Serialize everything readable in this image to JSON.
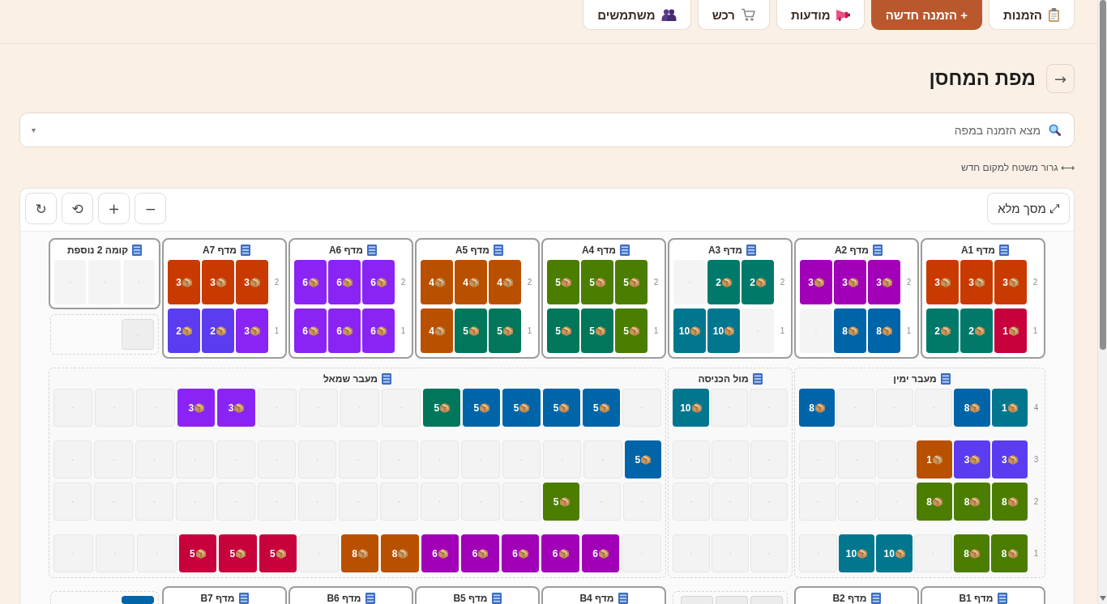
{
  "nav": [
    {
      "label": "הזמנות",
      "primary": false
    },
    {
      "label": "+ הזמנה חדשה",
      "primary": true
    },
    {
      "label": "מודעות",
      "primary": false
    },
    {
      "label": "רכש",
      "primary": false
    },
    {
      "label": "משתמשים",
      "primary": false
    }
  ],
  "header": {
    "back": "→",
    "title": "מפת המחסן"
  },
  "search": {
    "placeholder": "מצא הזמנה במפה",
    "caret": "▾"
  },
  "hint": "⟷ גרור משטח למקום חדש",
  "map": {
    "fullscreen": "⤢ מסך מלא",
    "tools": [
      "−",
      "+",
      "⟲",
      "↻"
    ],
    "top_row": [
      {
        "kind": "shelf",
        "title": "מדף A1",
        "levels": [
          {
            "label": "2",
            "slots": [
              {
                "kind": "pallet",
                "count": "3",
                "color": "#c93a00"
              },
              {
                "kind": "pallet",
                "count": "3",
                "color": "#c93a00"
              },
              {
                "kind": "pallet",
                "count": "3",
                "color": "#c93a00"
              }
            ]
          },
          {
            "label": "1",
            "slots": [
              {
                "kind": "pallet",
                "count": "1",
                "color": "#c8003c"
              },
              {
                "kind": "pallet",
                "count": "2",
                "color": "#00796b"
              },
              {
                "kind": "pallet",
                "count": "2",
                "color": "#00796b"
              }
            ]
          }
        ]
      },
      {
        "kind": "shelf",
        "title": "מדף A2",
        "levels": [
          {
            "label": "2",
            "slots": [
              {
                "kind": "pallet",
                "count": "3",
                "color": "#a100b8"
              },
              {
                "kind": "pallet",
                "count": "3",
                "color": "#a100b8"
              },
              {
                "kind": "pallet",
                "count": "3",
                "color": "#a100b8"
              }
            ]
          },
          {
            "label": "1",
            "slots": [
              {
                "kind": "pallet",
                "count": "8",
                "color": "#0064a8"
              },
              {
                "kind": "pallet",
                "count": "8",
                "color": "#0064a8"
              },
              {
                "kind": "empty",
                "label": "·"
              }
            ]
          }
        ]
      },
      {
        "kind": "shelf",
        "title": "מדף A3",
        "levels": [
          {
            "label": "2",
            "slots": [
              {
                "kind": "pallet",
                "count": "2",
                "color": "#00796b"
              },
              {
                "kind": "pallet",
                "count": "2",
                "color": "#00796b"
              },
              {
                "kind": "empty",
                "label": "·"
              }
            ]
          },
          {
            "label": "1",
            "slots": [
              {
                "kind": "empty",
                "label": "·"
              },
              {
                "kind": "pallet",
                "count": "10",
                "color": "#00778f"
              },
              {
                "kind": "pallet",
                "count": "10",
                "color": "#00778f"
              }
            ]
          }
        ]
      },
      {
        "kind": "shelf",
        "title": "מדף A4",
        "levels": [
          {
            "label": "2",
            "slots": [
              {
                "kind": "pallet",
                "count": "5",
                "color": "#4b7d00"
              },
              {
                "kind": "pallet",
                "count": "5",
                "color": "#4b7d00"
              },
              {
                "kind": "pallet",
                "count": "5",
                "color": "#4b7d00"
              }
            ]
          },
          {
            "label": "1",
            "slots": [
              {
                "kind": "pallet",
                "count": "5",
                "color": "#4b7d00"
              },
              {
                "kind": "pallet",
                "count": "5",
                "color": "#00775a"
              },
              {
                "kind": "pallet",
                "count": "5",
                "color": "#00775a"
              }
            ]
          }
        ]
      },
      {
        "kind": "shelf",
        "title": "מדף A5",
        "levels": [
          {
            "label": "2",
            "slots": [
              {
                "kind": "pallet",
                "count": "4",
                "color": "#b95000"
              },
              {
                "kind": "pallet",
                "count": "4",
                "color": "#b95000"
              },
              {
                "kind": "pallet",
                "count": "4",
                "color": "#b95000"
              }
            ]
          },
          {
            "label": "1",
            "slots": [
              {
                "kind": "pallet",
                "count": "5",
                "color": "#00775a"
              },
              {
                "kind": "pallet",
                "count": "5",
                "color": "#00775a"
              },
              {
                "kind": "pallet",
                "count": "4",
                "color": "#b95000"
              }
            ]
          }
        ]
      },
      {
        "kind": "shelf",
        "title": "מדף A6",
        "levels": [
          {
            "label": "2",
            "slots": [
              {
                "kind": "pallet",
                "count": "6",
                "color": "#8a24f5"
              },
              {
                "kind": "pallet",
                "count": "6",
                "color": "#8a24f5"
              },
              {
                "kind": "pallet",
                "count": "6",
                "color": "#8a24f5"
              }
            ]
          },
          {
            "label": "1",
            "slots": [
              {
                "kind": "pallet",
                "count": "6",
                "color": "#8a24f5"
              },
              {
                "kind": "pallet",
                "count": "6",
                "color": "#8a24f5"
              },
              {
                "kind": "pallet",
                "count": "6",
                "color": "#8a24f5"
              }
            ]
          }
        ]
      },
      {
        "kind": "shelf",
        "title": "מדף A7",
        "levels": [
          {
            "label": "2",
            "slots": [
              {
                "kind": "pallet",
                "count": "3",
                "color": "#c93a00"
              },
              {
                "kind": "pallet",
                "count": "3",
                "color": "#c93a00"
              },
              {
                "kind": "pallet",
                "count": "3",
                "color": "#c93a00"
              }
            ]
          },
          {
            "label": "1",
            "slots": [
              {
                "kind": "pallet",
                "count": "3",
                "color": "#8a24f5"
              },
              {
                "kind": "pallet",
                "count": "2",
                "color": "#5b3cf0"
              },
              {
                "kind": "pallet",
                "count": "2",
                "color": "#5b3cf0"
              }
            ]
          }
        ]
      },
      {
        "kind": "floor",
        "title": "קומה 2 נוספת",
        "slots": [
          {
            "kind": "empty",
            "label": "·"
          },
          {
            "kind": "empty",
            "label": "·"
          },
          {
            "kind": "empty",
            "label": "·"
          }
        ],
        "extra_slots": [
          {
            "kind": "empty",
            "label": "·"
          }
        ]
      }
    ],
    "aisles": [
      {
        "title": "מעבר ימין",
        "rows": [
          {
            "label": "4",
            "slots": [
              {
                "kind": "pallet",
                "count": "1",
                "color": "#00778f"
              },
              {
                "kind": "pallet",
                "count": "8",
                "color": "#0064a8"
              },
              {
                "kind": "empty",
                "label": "·"
              },
              {
                "kind": "empty",
                "label": "·"
              },
              {
                "kind": "empty",
                "label": "·"
              },
              {
                "kind": "pallet",
                "count": "8",
                "color": "#0064a8"
              }
            ]
          },
          {
            "label": "3",
            "slots": [
              {
                "kind": "pallet",
                "count": "3",
                "color": "#5b3cf0"
              },
              {
                "kind": "pallet",
                "count": "3",
                "color": "#5b3cf0"
              },
              {
                "kind": "pallet",
                "count": "1",
                "color": "#b95000"
              },
              {
                "kind": "empty",
                "label": "·"
              },
              {
                "kind": "empty",
                "label": "·"
              },
              {
                "kind": "empty",
                "label": "·"
              }
            ]
          },
          {
            "label": "2",
            "slots": [
              {
                "kind": "pallet",
                "count": "8",
                "color": "#4b7d00"
              },
              {
                "kind": "pallet",
                "count": "8",
                "color": "#4b7d00"
              },
              {
                "kind": "pallet",
                "count": "8",
                "color": "#4b7d00"
              },
              {
                "kind": "empty",
                "label": "·"
              },
              {
                "kind": "empty",
                "label": "·"
              },
              {
                "kind": "empty",
                "label": "·"
              }
            ]
          },
          {
            "label": "1",
            "slots": [
              {
                "kind": "pallet",
                "count": "8",
                "color": "#4b7d00"
              },
              {
                "kind": "pallet",
                "count": "8",
                "color": "#4b7d00"
              },
              {
                "kind": "empty",
                "label": "·"
              },
              {
                "kind": "pallet",
                "count": "10",
                "color": "#00778f"
              },
              {
                "kind": "pallet",
                "count": "10",
                "color": "#00778f"
              },
              {
                "kind": "empty",
                "label": "·"
              }
            ]
          }
        ]
      },
      {
        "title": "מול הכניסה",
        "rows": [
          {
            "slots": [
              {
                "kind": "empty",
                "label": "·"
              },
              {
                "kind": "empty",
                "label": "·"
              },
              {
                "kind": "pallet",
                "count": "10",
                "color": "#00778f"
              }
            ]
          },
          {
            "slots": [
              {
                "kind": "empty",
                "label": "·"
              },
              {
                "kind": "empty",
                "label": "·"
              },
              {
                "kind": "empty",
                "label": "·"
              }
            ]
          },
          {
            "slots": [
              {
                "kind": "empty",
                "label": "·"
              },
              {
                "kind": "empty",
                "label": "·"
              },
              {
                "kind": "empty",
                "label": "·"
              }
            ]
          },
          {
            "slots": [
              {
                "kind": "empty",
                "label": "·"
              },
              {
                "kind": "empty",
                "label": "·"
              },
              {
                "kind": "empty",
                "label": "·"
              }
            ]
          }
        ]
      },
      {
        "title": "מעבר שמאל",
        "rows": [
          {
            "slots": [
              {
                "kind": "empty",
                "label": "·"
              },
              {
                "kind": "pallet",
                "count": "5",
                "color": "#0064a8"
              },
              {
                "kind": "pallet",
                "count": "5",
                "color": "#0064a8"
              },
              {
                "kind": "pallet",
                "count": "5",
                "color": "#0064a8"
              },
              {
                "kind": "pallet",
                "count": "5",
                "color": "#0064a8"
              },
              {
                "kind": "pallet",
                "count": "5",
                "color": "#00775a"
              },
              {
                "kind": "empty",
                "label": "·"
              },
              {
                "kind": "empty",
                "label": "·"
              },
              {
                "kind": "empty",
                "label": "·"
              },
              {
                "kind": "empty",
                "label": "·"
              },
              {
                "kind": "pallet",
                "count": "3",
                "color": "#8a24f5"
              },
              {
                "kind": "pallet",
                "count": "3",
                "color": "#8a24f5"
              },
              {
                "kind": "empty",
                "label": "·"
              },
              {
                "kind": "empty",
                "label": "·"
              },
              {
                "kind": "empty",
                "label": "·"
              }
            ]
          },
          {
            "slots": [
              {
                "kind": "pallet",
                "count": "5",
                "color": "#0064a8"
              },
              {
                "kind": "empty",
                "label": "·"
              },
              {
                "kind": "empty",
                "label": "·"
              },
              {
                "kind": "empty",
                "label": "·"
              },
              {
                "kind": "empty",
                "label": "·"
              },
              {
                "kind": "empty",
                "label": "·"
              },
              {
                "kind": "empty",
                "label": "·"
              },
              {
                "kind": "empty",
                "label": "·"
              },
              {
                "kind": "empty",
                "label": "·"
              },
              {
                "kind": "empty",
                "label": "·"
              },
              {
                "kind": "empty",
                "label": "·"
              },
              {
                "kind": "empty",
                "label": "·"
              },
              {
                "kind": "empty",
                "label": "·"
              },
              {
                "kind": "empty",
                "label": "·"
              },
              {
                "kind": "empty",
                "label": "·"
              }
            ]
          },
          {
            "slots": [
              {
                "kind": "empty",
                "label": "·"
              },
              {
                "kind": "empty",
                "label": "·"
              },
              {
                "kind": "pallet",
                "count": "5",
                "color": "#4b7d00"
              },
              {
                "kind": "empty",
                "label": "·"
              },
              {
                "kind": "empty",
                "label": "·"
              },
              {
                "kind": "empty",
                "label": "·"
              },
              {
                "kind": "empty",
                "label": "·"
              },
              {
                "kind": "empty",
                "label": "·"
              },
              {
                "kind": "empty",
                "label": "·"
              },
              {
                "kind": "empty",
                "label": "·"
              },
              {
                "kind": "empty",
                "label": "·"
              },
              {
                "kind": "empty",
                "label": "·"
              },
              {
                "kind": "empty",
                "label": "·"
              },
              {
                "kind": "empty",
                "label": "·"
              },
              {
                "kind": "empty",
                "label": "·"
              }
            ]
          },
          {
            "slots": [
              {
                "kind": "empty",
                "label": "·"
              },
              {
                "kind": "pallet",
                "count": "6",
                "color": "#a100b8"
              },
              {
                "kind": "pallet",
                "count": "6",
                "color": "#a100b8"
              },
              {
                "kind": "pallet",
                "count": "6",
                "color": "#a100b8"
              },
              {
                "kind": "pallet",
                "count": "6",
                "color": "#a100b8"
              },
              {
                "kind": "pallet",
                "count": "6",
                "color": "#a100b8"
              },
              {
                "kind": "pallet",
                "count": "8",
                "color": "#b95000"
              },
              {
                "kind": "pallet",
                "count": "8",
                "color": "#b95000"
              },
              {
                "kind": "empty",
                "label": "·"
              },
              {
                "kind": "pallet",
                "count": "5",
                "color": "#c8003c"
              },
              {
                "kind": "pallet",
                "count": "5",
                "color": "#c8003c"
              },
              {
                "kind": "pallet",
                "count": "5",
                "color": "#c8003c"
              },
              {
                "kind": "empty",
                "label": "·"
              },
              {
                "kind": "empty",
                "label": "·"
              },
              {
                "kind": "empty",
                "label": "·"
              }
            ]
          }
        ]
      }
    ],
    "bottom_row": [
      {
        "kind": "shelf",
        "title": "מדף B1"
      },
      {
        "kind": "shelf",
        "title": "מדף B2"
      },
      {
        "kind": "staging",
        "slots": [
          {
            "kind": "empty"
          },
          {
            "kind": "empty"
          },
          {
            "kind": "empty"
          }
        ]
      },
      {
        "kind": "shelf",
        "title": "מדף B4"
      },
      {
        "kind": "shelf",
        "title": "מדף B5"
      },
      {
        "kind": "shelf",
        "title": "מדף B6"
      },
      {
        "kind": "shelf",
        "title": "מדף B7"
      },
      {
        "kind": "staging",
        "slots": [
          {
            "kind": "pallet",
            "color": "#0064a8"
          }
        ]
      }
    ]
  }
}
